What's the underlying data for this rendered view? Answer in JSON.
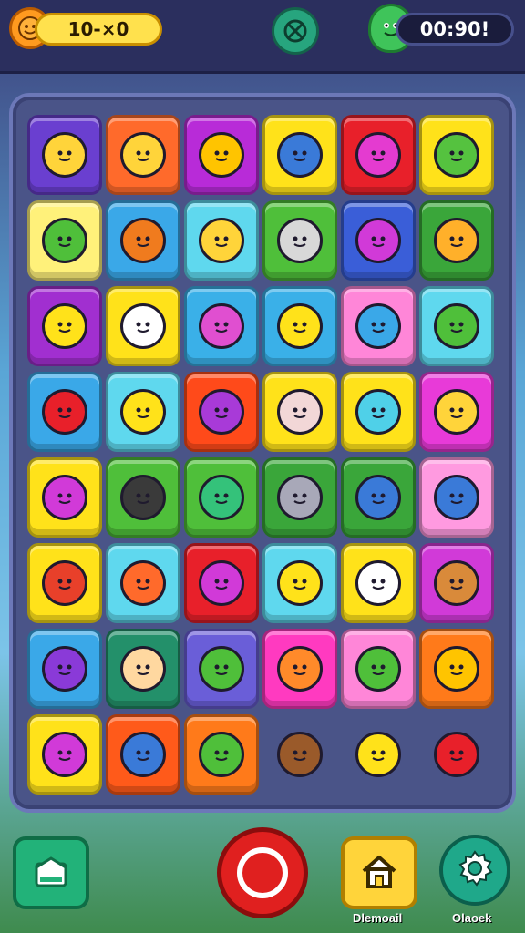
{
  "hud": {
    "score": "10-⨯0",
    "timer": "00:90!",
    "coin_icon": "smiley-coin-icon",
    "center_icon": "compass-icon",
    "monster_icon": "green-monster-icon"
  },
  "board": {
    "rows": [
      [
        {
          "bg": "#6a3fd0",
          "fg": "#ffd43a",
          "name": "sun-face-icon"
        },
        {
          "bg": "#ff6a2b",
          "fg": "#ffd43a",
          "name": "star-icon"
        },
        {
          "bg": "#b82bd8",
          "fg": "#ffc400",
          "name": "stopwatch-icon"
        },
        {
          "bg": "#ffe21a",
          "fg": "#3a7ad8",
          "name": "blue-germ-icon"
        },
        {
          "bg": "#e8202a",
          "fg": "#e43bd0",
          "name": "candy-icon"
        },
        {
          "bg": "#ffe21a",
          "fg": "#55c23f",
          "name": "leaf-icon"
        }
      ],
      [
        {
          "bg": "#fff17a",
          "fg": "#4fbf3a",
          "name": "pepper-icon"
        },
        {
          "bg": "#3aa8e8",
          "fg": "#f07b1e",
          "name": "pumpkin-icon"
        },
        {
          "bg": "#5fd8ee",
          "fg": "#ffd43a",
          "name": "check-badge-icon"
        },
        {
          "bg": "#4fbf3a",
          "fg": "#d8d8d8",
          "name": "toaster-icon"
        },
        {
          "bg": "#3a5ed8",
          "fg": "#d13ad8",
          "name": "disc-icon"
        },
        {
          "bg": "#3aa63a",
          "fg": "#ffb02a",
          "name": "cat-face-icon"
        }
      ],
      [
        {
          "bg": "#a12fd0",
          "fg": "#ffe21a",
          "name": "lemon-icon"
        },
        {
          "bg": "#ffe21a",
          "fg": "#ffffff",
          "name": "rocket-icon"
        },
        {
          "bg": "#3ab0e8",
          "fg": "#e04fd0",
          "name": "marker-icon"
        },
        {
          "bg": "#3ab0e8",
          "fg": "#ffe21a",
          "name": "crayon-icon"
        },
        {
          "bg": "#ff86d8",
          "fg": "#3aa8e8",
          "name": "gear-blob-icon"
        },
        {
          "bg": "#5fd8ee",
          "fg": "#4fbf3a",
          "name": "pencil-badge-icon"
        }
      ],
      [
        {
          "bg": "#3aa8e8",
          "fg": "#e8202a",
          "name": "gem-icon"
        },
        {
          "bg": "#5fd8ee",
          "fg": "#ffe21a",
          "name": "wizard-icon"
        },
        {
          "bg": "#ff4a1a",
          "fg": "#a83ad8",
          "name": "jelly-icon"
        },
        {
          "bg": "#ffe21a",
          "fg": "#f2d7d7",
          "name": "envelope-icon"
        },
        {
          "bg": "#ffe21a",
          "fg": "#4fd0e8",
          "name": "water-drop-icon"
        },
        {
          "bg": "#e83ad8",
          "fg": "#ffd43a",
          "name": "egg-icon"
        }
      ],
      [
        {
          "bg": "#ffe21a",
          "fg": "#d13ad8",
          "name": "moon-gem-icon"
        },
        {
          "bg": "#4fbf3a",
          "fg": "#3a3a3a",
          "name": "ring-icon"
        },
        {
          "bg": "#4fbf3a",
          "fg": "#34c27a",
          "name": "green-splat-icon"
        },
        {
          "bg": "#3aa63a",
          "fg": "#a8a8b8",
          "name": "skull-icon"
        },
        {
          "bg": "#3aa63a",
          "fg": "#3a7ad8",
          "name": "pot-icon"
        },
        {
          "bg": "#ff9ae0",
          "fg": "#3a7ad8",
          "name": "target-icon"
        }
      ],
      [
        {
          "bg": "#ffe21a",
          "fg": "#e8402a",
          "name": "berry-icon"
        },
        {
          "bg": "#5fd8ee",
          "fg": "#ff6a2b",
          "name": "no-pencil-icon"
        },
        {
          "bg": "#e8202a",
          "fg": "#d13ad8",
          "name": "fish-icon"
        },
        {
          "bg": "#5fd8ee",
          "fg": "#ffe21a",
          "name": "bubble-icon"
        },
        {
          "bg": "#ffe21a",
          "fg": "#ffffff",
          "name": "knife-icon"
        },
        {
          "bg": "#d13ad8",
          "fg": "#d98a3a",
          "name": "hammer-icon"
        }
      ],
      [
        {
          "bg": "#3aa8e8",
          "fg": "#8a3ad8",
          "name": "plum-icon"
        },
        {
          "bg": "#23906a",
          "fg": "#ffd8a0",
          "name": "lion-icon"
        },
        {
          "bg": "#6a5ed8",
          "fg": "#4fbf3a",
          "name": "bug-icon"
        },
        {
          "bg": "#ff3ac0",
          "fg": "#ff8a2a",
          "name": "shell-icon"
        },
        {
          "bg": "#ff86d8",
          "fg": "#4fbf3a",
          "name": "green-leaf-icon"
        },
        {
          "bg": "#ff7a1a",
          "fg": "#ffc400",
          "name": "orange-icon"
        }
      ],
      [
        {
          "bg": "#ffe21a",
          "fg": "#d13ad8",
          "name": "drill-icon"
        },
        {
          "bg": "#ff5a1a",
          "fg": "#3a7ad8",
          "name": "saw-icon"
        },
        {
          "bg": "#ff7a1a",
          "fg": "#4fbf3a",
          "name": "green-disc-icon"
        },
        {
          "bg": "",
          "fg": "#9a5a2a",
          "name": "coconut-icon"
        },
        {
          "bg": "",
          "fg": "#ffe21a",
          "name": "yellow-face-icon"
        },
        {
          "bg": "",
          "fg": "#e8202a",
          "name": "strawberry-icon"
        }
      ]
    ]
  },
  "buttons": {
    "home_label": "Dlemoail",
    "settings_label": "Olaoek",
    "shop_icon": "shop-icon",
    "record_icon": "record-icon",
    "home_icon": "house-icon",
    "gear_icon": "gear-icon"
  }
}
